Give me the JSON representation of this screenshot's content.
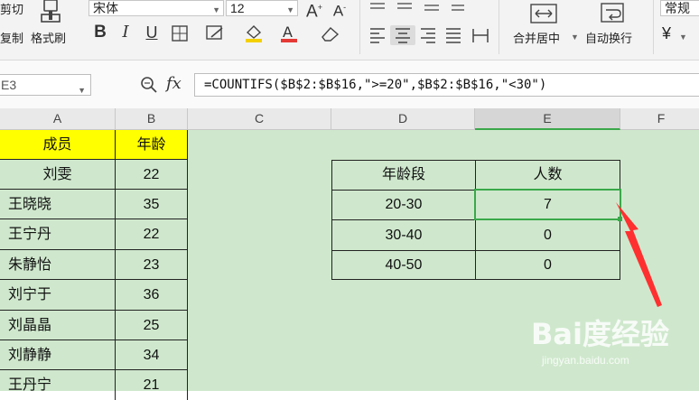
{
  "ribbon": {
    "cut_label": "剪切",
    "copy_label": "复制",
    "format_painter_label": "格式刷",
    "font_name": "宋体",
    "font_size": "12",
    "merge_center_label": "合并居中",
    "wrap_text_label": "自动换行",
    "number_format": "常规",
    "currency_symbol": "¥"
  },
  "formula_bar": {
    "name_box": "E3",
    "fx_label": "fx",
    "formula": "=COUNTIFS($B$2:$B$16,\">=20\",$B$2:$B$16,\"<30\")"
  },
  "columns": [
    "A",
    "B",
    "C",
    "D",
    "E",
    "F"
  ],
  "sheet": {
    "header_name": "成员",
    "header_age": "年龄",
    "members": [
      {
        "name": "刘雯",
        "age": "22"
      },
      {
        "name": "王晓晓",
        "age": "35"
      },
      {
        "name": "王宁丹",
        "age": "22"
      },
      {
        "name": "朱静怡",
        "age": "23"
      },
      {
        "name": "刘宁于",
        "age": "36"
      },
      {
        "name": "刘晶晶",
        "age": "25"
      },
      {
        "name": "刘静静",
        "age": "34"
      },
      {
        "name": "王丹宁",
        "age": "21"
      }
    ],
    "summary_header_range": "年龄段",
    "summary_header_count": "人数",
    "summary": [
      {
        "range": "20-30",
        "count": "7"
      },
      {
        "range": "30-40",
        "count": "0"
      },
      {
        "range": "40-50",
        "count": "0"
      }
    ]
  },
  "colors": {
    "accent_green": "#3aa84a",
    "header_yellow": "#ffff00",
    "arrow_red": "#ff3030",
    "sheet_bg": "#cfe8cd"
  },
  "watermark": {
    "main": "Bai度经验",
    "sub": "jingyan.baidu.com"
  }
}
